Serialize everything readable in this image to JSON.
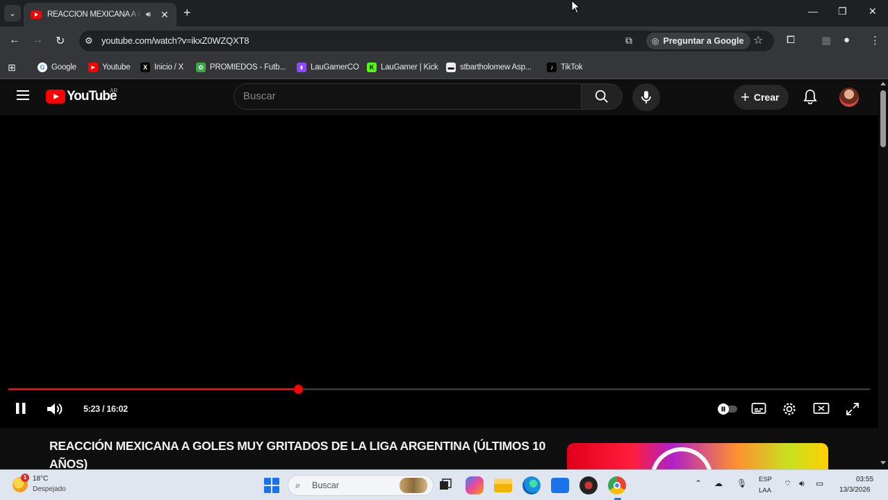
{
  "browser": {
    "tab": {
      "title": "REACCIÓN MEXICANA A GOLES MUY GRITADOS",
      "audio_icon": "speaker-icon"
    },
    "url": "youtube.com/watch?v=ikxZ0WZQXT8",
    "ask_google_label": "Preguntar a Google",
    "bookmarks": [
      {
        "label": "Google",
        "color": "#4285f4",
        "glyph": "G"
      },
      {
        "label": "Youtube",
        "color": "#ff0000",
        "glyph": "▶"
      },
      {
        "label": "Inicio / X",
        "color": "#000000",
        "glyph": "X"
      },
      {
        "label": "PROMIEDOS - Futb...",
        "color": "#3aa845",
        "glyph": "✿"
      },
      {
        "label": "LauGamerCO",
        "color": "#9146ff",
        "glyph": "▮"
      },
      {
        "label": "LauGamer | Kick",
        "color": "#53fc18",
        "glyph": "K"
      },
      {
        "label": "stbartholomew Asp...",
        "color": "#222222",
        "glyph": "▬"
      },
      {
        "label": "TikTok",
        "color": "#000000",
        "glyph": "♪"
      }
    ]
  },
  "youtube": {
    "logo_text": "YouTube",
    "region": "AR",
    "search_placeholder": "Buscar",
    "create_label": "Crear",
    "player": {
      "current_time": "5:23",
      "duration": "16:02",
      "time_display": "5:23 / 16:02",
      "progress_fraction": 0.336
    },
    "video_title": "REACCIÓN MEXICANA A GOLES MUY GRITADOS DE LA LIGA ARGENTINA (ÚLTIMOS 10 AÑOS)"
  },
  "taskbar": {
    "weather_temp": "18°C",
    "weather_condition": "Despejado",
    "weather_badge": "1",
    "search_label": "Buscar",
    "lang_top": "ESP",
    "lang_bottom": "LAA",
    "clock_time": "03:55",
    "clock_date": "13/3/2026"
  },
  "colors": {
    "accent": "#ff0000",
    "background": "#0f0f0f"
  }
}
